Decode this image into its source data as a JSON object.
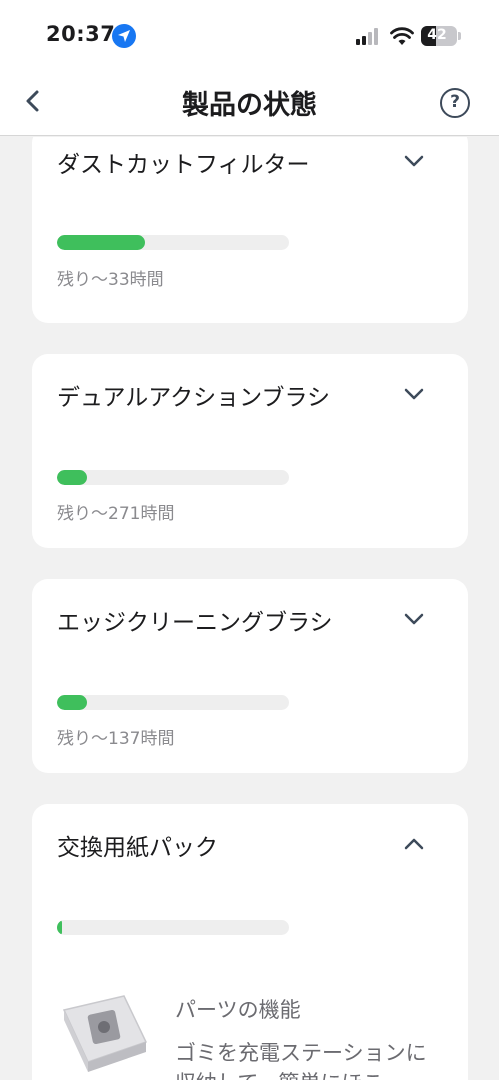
{
  "status_bar": {
    "time": "20:37",
    "battery": "42",
    "battery_level": 0.42,
    "icons": [
      "location-arrow-icon",
      "cellular-signal-icon",
      "wifi-icon",
      "battery-icon"
    ]
  },
  "header": {
    "title": "製品の状態",
    "back_icon": "chevron-left-icon",
    "help_label": "?"
  },
  "colors": {
    "accent": "#3fbf5c",
    "icon": "#3d4a5a",
    "background": "#f1f1f1"
  },
  "parts": [
    {
      "name": "ダストカットフィルター",
      "remaining": "残り～33時間",
      "progress": 0.38,
      "expanded": false
    },
    {
      "name": "デュアルアクションブラシ",
      "remaining": "残り～271時間",
      "progress": 0.13,
      "expanded": false
    },
    {
      "name": "エッジクリーニングブラシ",
      "remaining": "残り～137時間",
      "progress": 0.13,
      "expanded": false
    },
    {
      "name": "交換用紙パック",
      "remaining": "",
      "progress": 0.02,
      "expanded": true,
      "feature_title": "パーツの機能",
      "feature_desc": "ゴミを充電ステーションに収納して、簡単にほこ"
    }
  ]
}
